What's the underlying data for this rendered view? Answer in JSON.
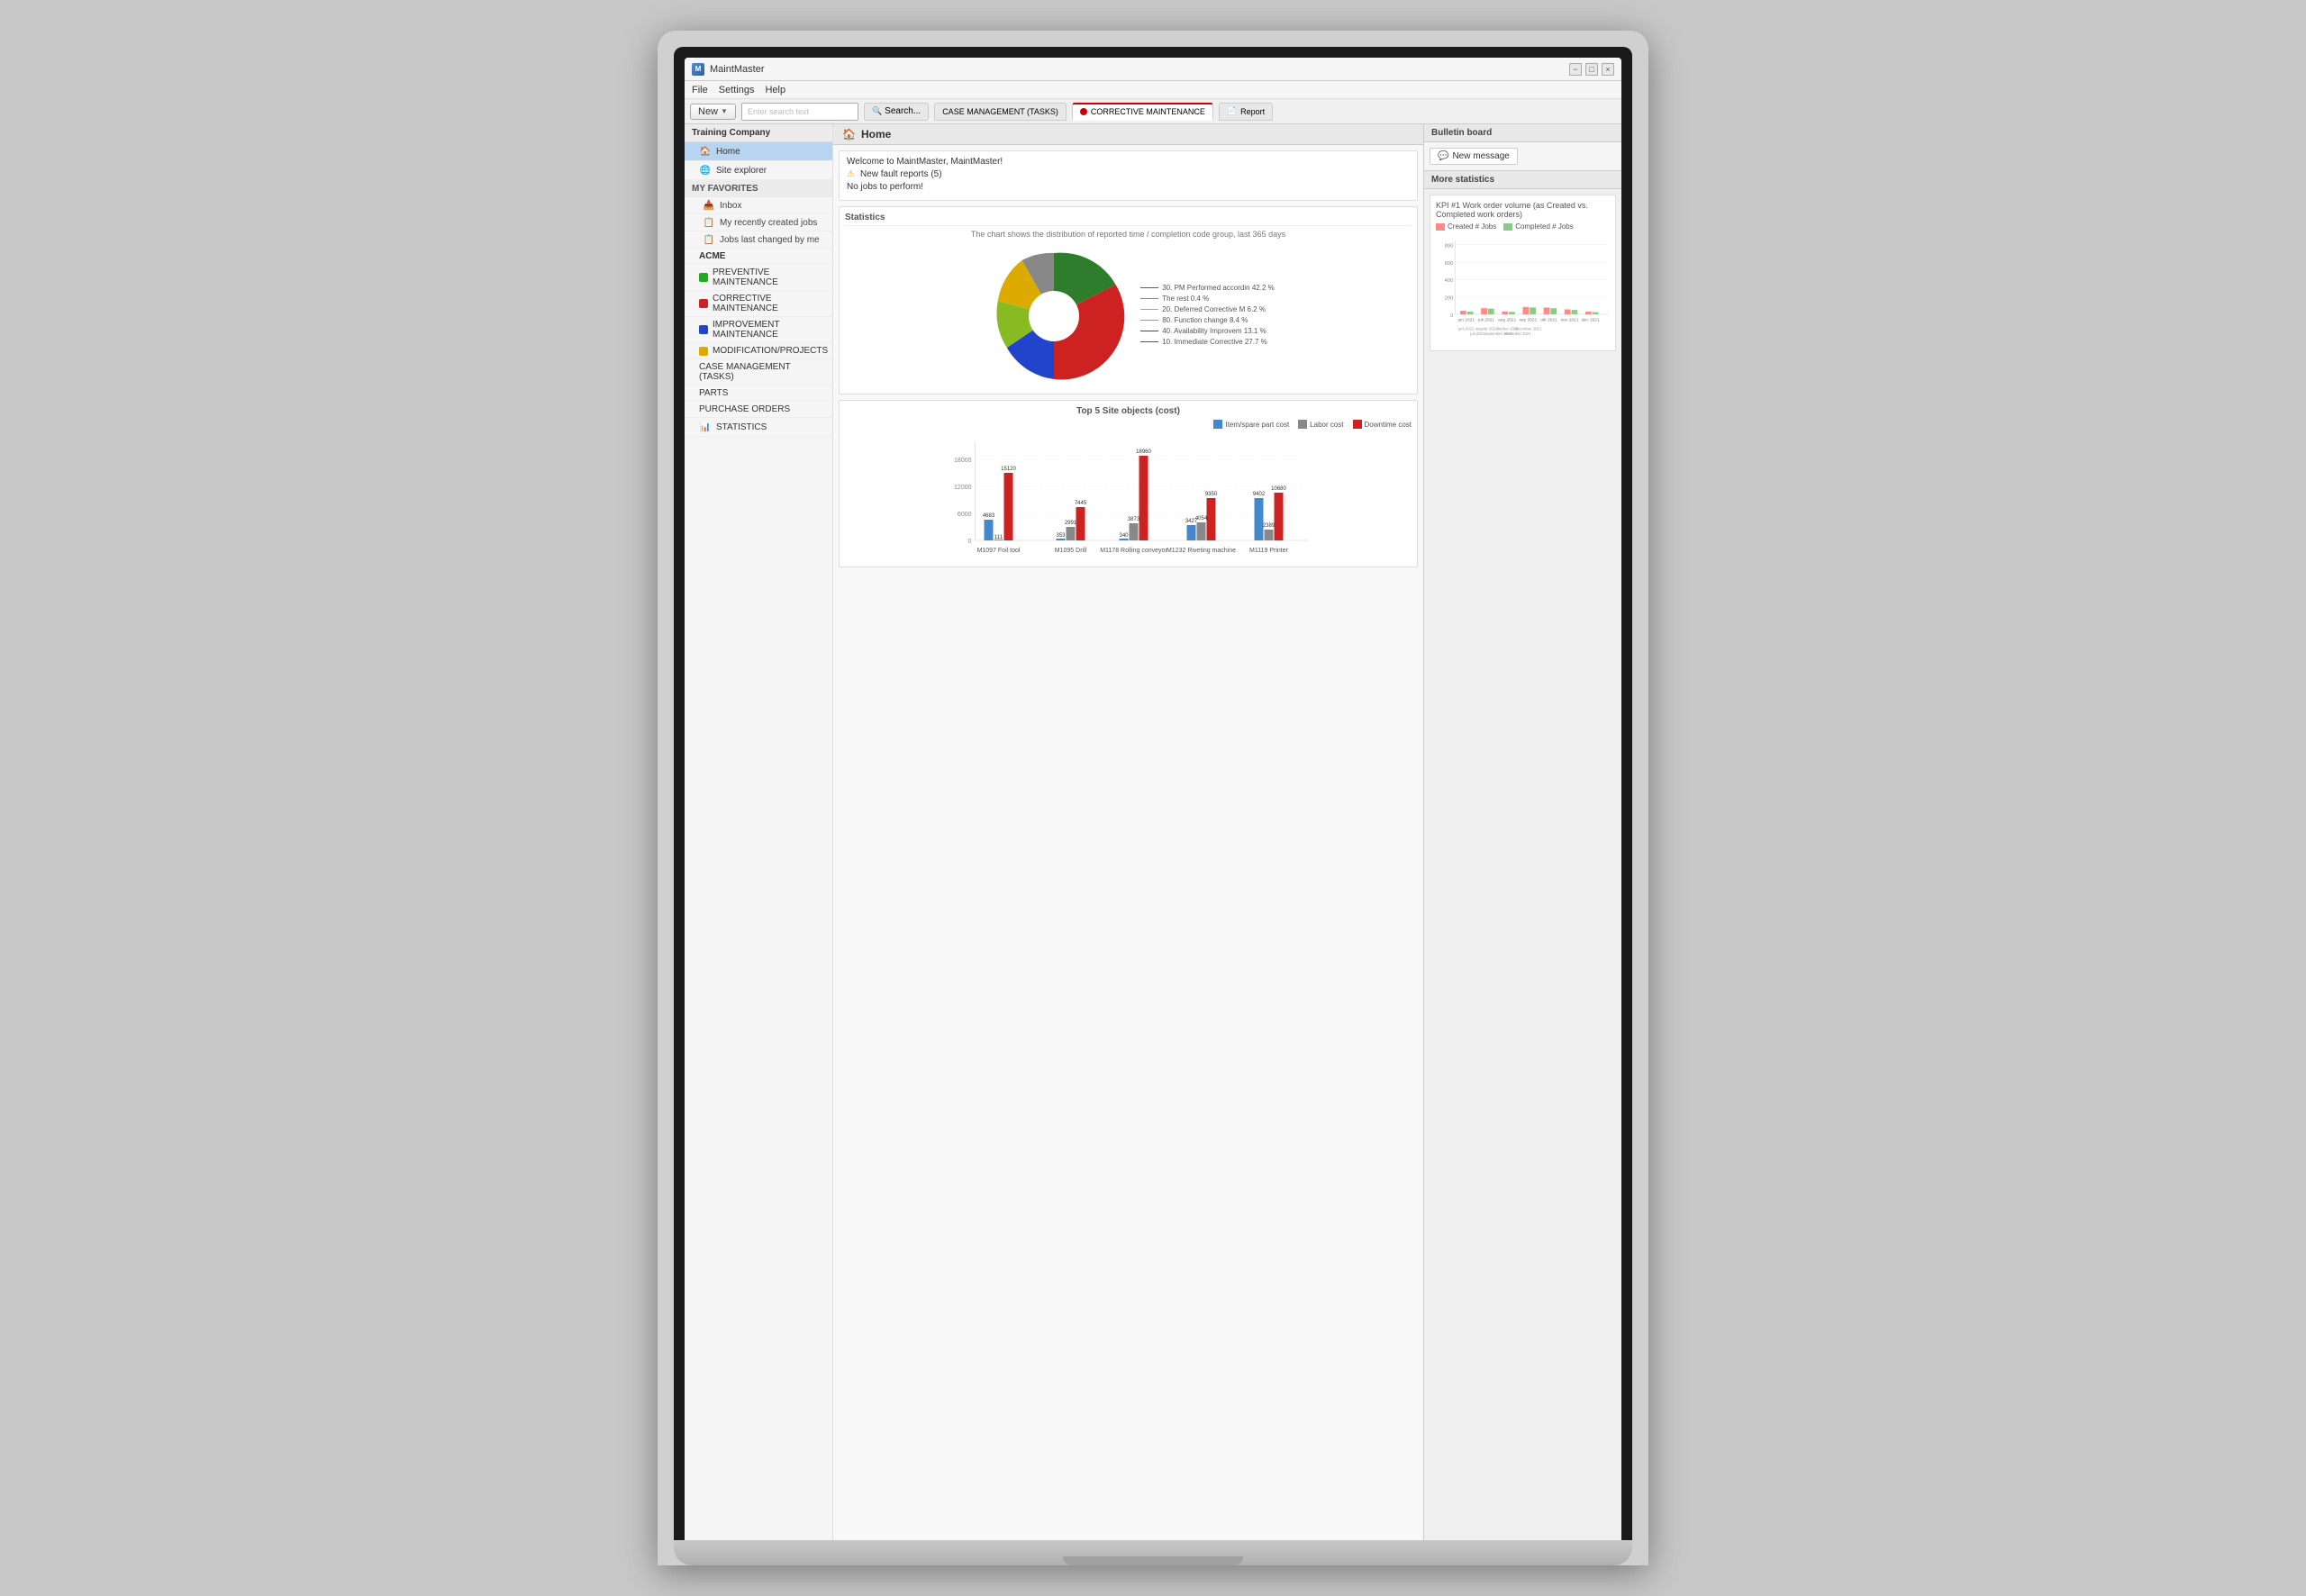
{
  "app": {
    "title": "MaintMaster",
    "icon": "M"
  },
  "titlebar": {
    "minimize": "−",
    "maximize": "□",
    "close": "×"
  },
  "menu": {
    "items": [
      "File",
      "Settings",
      "Help"
    ]
  },
  "toolbar": {
    "new_label": "New",
    "dropdown_arrow": "▼",
    "search_placeholder": "Enter search text",
    "search_btn": "Search...",
    "tabs": [
      {
        "label": "CASE MANAGEMENT (TASKS)",
        "color": "",
        "active": false
      },
      {
        "label": "CORRECTIVE MAINTENANCE",
        "color": "#cc0000",
        "active": true
      },
      {
        "label": "Report",
        "color": "",
        "active": false
      }
    ]
  },
  "sidebar": {
    "company": "Training Company",
    "items": [
      {
        "label": "Home",
        "icon": "🏠",
        "active": true,
        "level": 1
      },
      {
        "label": "Site explorer",
        "icon": "🌐",
        "active": false,
        "level": 1
      }
    ],
    "my_favorites": {
      "title": "MY FAVORITES",
      "items": [
        {
          "label": "Inbox",
          "icon": "📥"
        },
        {
          "label": "My recently created jobs",
          "icon": "📋"
        },
        {
          "label": "Jobs last changed by me",
          "icon": "📋"
        }
      ]
    },
    "groups": [
      {
        "label": "ACME",
        "color": "",
        "indent": false
      },
      {
        "label": "PREVENTIVE MAINTENANCE",
        "color": "#22aa22",
        "indent": false
      },
      {
        "label": "CORRECTIVE MAINTENANCE",
        "color": "#cc2222",
        "indent": false
      },
      {
        "label": "IMPROVEMENT MAINTENANCE",
        "color": "#2244cc",
        "indent": false
      },
      {
        "label": "MODIFICATION/PROJECTS",
        "color": "#ddaa00",
        "indent": false
      },
      {
        "label": "CASE MANAGEMENT (TASKS)",
        "color": "",
        "indent": false
      },
      {
        "label": "PARTS",
        "color": "",
        "indent": false
      },
      {
        "label": "PURCHASE ORDERS",
        "color": "",
        "indent": false
      },
      {
        "label": "STATISTICS",
        "color": "",
        "indent": false
      }
    ]
  },
  "home": {
    "title": "Home",
    "welcome_msg": "Welcome to MaintMaster, MaintMaster!",
    "notifications": [
      {
        "text": "New fault reports (5)",
        "icon": "⚠"
      },
      {
        "text": "No jobs to perform!"
      }
    ]
  },
  "statistics": {
    "title": "Statistics",
    "chart_description": "The chart shows the distribution of reported time / completion code group, last 365 days",
    "pie_segments": [
      {
        "label": "30. PM Performed accordin 42.2 %",
        "color": "#2d7d2d",
        "value": 42.2,
        "startAngle": 0
      },
      {
        "label": "10. Immediate Corrective  27.7 %",
        "color": "#cc2222",
        "value": 27.7
      },
      {
        "label": "40. Availability Improvem 13.1 %",
        "color": "#2244cc",
        "value": 13.1
      },
      {
        "label": "80. Function change 8.4 %",
        "color": "#88bb22",
        "value": 8.4
      },
      {
        "label": "20. Deferred Corrective M 6.2 %",
        "color": "#ddaa00",
        "value": 6.2
      },
      {
        "label": "The rest 0.4 %",
        "color": "#666666",
        "value": 0.4
      }
    ],
    "top5_title": "Top 5 Site objects (cost)",
    "top5_legend": [
      {
        "label": "Item/spare part cost",
        "color": "#4488cc"
      },
      {
        "label": "Labor cost",
        "color": "#888888"
      },
      {
        "label": "Downtime cost",
        "color": "#cc2222"
      }
    ],
    "top5_sites": [
      {
        "name": "M1097 Foil tool",
        "item": 4683,
        "labor": 111,
        "downtime": 15120
      },
      {
        "name": "M1095 Drill",
        "item": 353,
        "labor": 2991,
        "downtime": 7445
      },
      {
        "name": "M1178 Rolling conveyor",
        "item": 340,
        "labor": 3873,
        "downtime": 18960
      },
      {
        "name": "M1232 Riveting machine",
        "item": 3427,
        "labor": 4054,
        "downtime": 9350
      },
      {
        "name": "M1119 Printer",
        "item": 9402,
        "labor": 2389,
        "downtime": 10680
      }
    ]
  },
  "bulletin": {
    "title": "Bulletin board",
    "new_message_label": "New message"
  },
  "more_stats": {
    "title": "More statistics",
    "kpi_title": "KPI #1 Work order volume (as Created vs. Completed work orders)",
    "legend": [
      {
        "label": "Created # Jobs",
        "color": "#ff8888"
      },
      {
        "label": "Completed # Jobs",
        "color": "#88cc88"
      }
    ],
    "months": [
      "jun 2021",
      "juli 2021",
      "augusti 2021",
      "september 2021",
      "oktober 2021",
      "november 2021",
      "december 2021"
    ],
    "created": [
      35,
      72,
      32,
      84,
      77,
      56,
      30
    ],
    "completed": [
      30,
      65,
      28,
      78,
      70,
      50,
      25
    ],
    "y_axis": [
      "0",
      "200",
      "400",
      "600",
      "800"
    ]
  }
}
